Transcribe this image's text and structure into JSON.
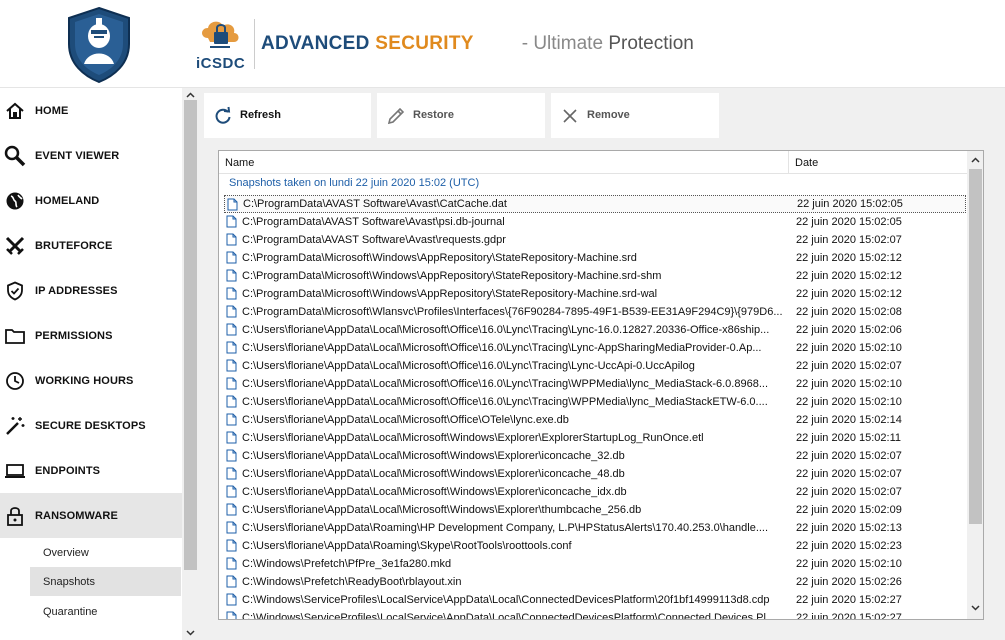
{
  "header": {
    "brand_short": "iCSDC",
    "title_main": "ADVANCED",
    "title_accent": "SECURITY",
    "subtitle_light": "- Ultimate ",
    "subtitle_dark": "Protection"
  },
  "sidebar": {
    "items": [
      {
        "label": "HOME",
        "icon": "home-icon"
      },
      {
        "label": "EVENT VIEWER",
        "icon": "magnifier-icon"
      },
      {
        "label": "HOMELAND",
        "icon": "globe-icon"
      },
      {
        "label": "BRUTEFORCE",
        "icon": "crossed-swords-icon"
      },
      {
        "label": "IP ADDRESSES",
        "icon": "shield-check-icon"
      },
      {
        "label": "PERMISSIONS",
        "icon": "folder-icon"
      },
      {
        "label": "WORKING HOURS",
        "icon": "clock-icon"
      },
      {
        "label": "SECURE DESKTOPS",
        "icon": "magic-wand-icon"
      },
      {
        "label": "ENDPOINTS",
        "icon": "laptop-icon"
      },
      {
        "label": "RANSOMWARE",
        "icon": "padlock-icon"
      }
    ],
    "subitems": [
      {
        "label": "Overview"
      },
      {
        "label": "Snapshots"
      },
      {
        "label": "Quarantine"
      }
    ],
    "active_item": "RANSOMWARE",
    "active_subitem": "Snapshots"
  },
  "toolbar": {
    "refresh_label": "Refresh",
    "restore_label": "Restore",
    "remove_label": "Remove"
  },
  "table": {
    "columns": [
      "Name",
      "Date"
    ],
    "group_label": "Snapshots taken on lundi 22 juin 2020 15:02 (UTC)",
    "rows": [
      {
        "path": "C:\\ProgramData\\AVAST Software\\Avast\\CatCache.dat",
        "date": "22 juin 2020 15:02:05"
      },
      {
        "path": "C:\\ProgramData\\AVAST Software\\Avast\\psi.db-journal",
        "date": "22 juin 2020 15:02:05"
      },
      {
        "path": "C:\\ProgramData\\AVAST Software\\Avast\\requests.gdpr",
        "date": "22 juin 2020 15:02:07"
      },
      {
        "path": "C:\\ProgramData\\Microsoft\\Windows\\AppRepository\\StateRepository-Machine.srd",
        "date": "22 juin 2020 15:02:12"
      },
      {
        "path": "C:\\ProgramData\\Microsoft\\Windows\\AppRepository\\StateRepository-Machine.srd-shm",
        "date": "22 juin 2020 15:02:12"
      },
      {
        "path": "C:\\ProgramData\\Microsoft\\Windows\\AppRepository\\StateRepository-Machine.srd-wal",
        "date": "22 juin 2020 15:02:12"
      },
      {
        "path": "C:\\ProgramData\\Microsoft\\Wlansvc\\Profiles\\Interfaces\\{76F90284-7895-49F1-B539-EE31A9F294C9}\\{979D6...",
        "date": "22 juin 2020 15:02:08"
      },
      {
        "path": "C:\\Users\\floriane\\AppData\\Local\\Microsoft\\Office\\16.0\\Lync\\Tracing\\Lync-16.0.12827.20336-Office-x86ship...",
        "date": "22 juin 2020 15:02:06"
      },
      {
        "path": "C:\\Users\\floriane\\AppData\\Local\\Microsoft\\Office\\16.0\\Lync\\Tracing\\Lync-AppSharingMediaProvider-0.Ap...",
        "date": "22 juin 2020 15:02:10"
      },
      {
        "path": "C:\\Users\\floriane\\AppData\\Local\\Microsoft\\Office\\16.0\\Lync\\Tracing\\Lync-UccApi-0.UccApilog",
        "date": "22 juin 2020 15:02:07"
      },
      {
        "path": "C:\\Users\\floriane\\AppData\\Local\\Microsoft\\Office\\16.0\\Lync\\Tracing\\WPPMedia\\lync_MediaStack-6.0.8968...",
        "date": "22 juin 2020 15:02:10"
      },
      {
        "path": "C:\\Users\\floriane\\AppData\\Local\\Microsoft\\Office\\16.0\\Lync\\Tracing\\WPPMedia\\lync_MediaStackETW-6.0....",
        "date": "22 juin 2020 15:02:10"
      },
      {
        "path": "C:\\Users\\floriane\\AppData\\Local\\Microsoft\\Office\\OTele\\lync.exe.db",
        "date": "22 juin 2020 15:02:14"
      },
      {
        "path": "C:\\Users\\floriane\\AppData\\Local\\Microsoft\\Windows\\Explorer\\ExplorerStartupLog_RunOnce.etl",
        "date": "22 juin 2020 15:02:11"
      },
      {
        "path": "C:\\Users\\floriane\\AppData\\Local\\Microsoft\\Windows\\Explorer\\iconcache_32.db",
        "date": "22 juin 2020 15:02:07"
      },
      {
        "path": "C:\\Users\\floriane\\AppData\\Local\\Microsoft\\Windows\\Explorer\\iconcache_48.db",
        "date": "22 juin 2020 15:02:07"
      },
      {
        "path": "C:\\Users\\floriane\\AppData\\Local\\Microsoft\\Windows\\Explorer\\iconcache_idx.db",
        "date": "22 juin 2020 15:02:07"
      },
      {
        "path": "C:\\Users\\floriane\\AppData\\Local\\Microsoft\\Windows\\Explorer\\thumbcache_256.db",
        "date": "22 juin 2020 15:02:09"
      },
      {
        "path": "C:\\Users\\floriane\\AppData\\Roaming\\HP Development Company, L.P\\HPStatusAlerts\\170.40.253.0\\handle....",
        "date": "22 juin 2020 15:02:13"
      },
      {
        "path": "C:\\Users\\floriane\\AppData\\Roaming\\Skype\\RootTools\\roottools.conf",
        "date": "22 juin 2020 15:02:23"
      },
      {
        "path": "C:\\Windows\\Prefetch\\PfPre_3e1fa280.mkd",
        "date": "22 juin 2020 15:02:10"
      },
      {
        "path": "C:\\Windows\\Prefetch\\ReadyBoot\\rblayout.xin",
        "date": "22 juin 2020 15:02:26"
      },
      {
        "path": "C:\\Windows\\ServiceProfiles\\LocalService\\AppData\\Local\\ConnectedDevicesPlatform\\20f1bf14999113d8.cdp",
        "date": "22 juin 2020 15:02:27"
      },
      {
        "path": "C:\\Windows\\ServiceProfiles\\LocalService\\AppData\\Local\\ConnectedDevicesPlatform\\Connected Devices Pl...",
        "date": "22 juin 2020 15:02:27"
      }
    ]
  },
  "colors": {
    "brand_blue": "#1e4c7a",
    "brand_orange": "#e08a1e",
    "group_blue": "#1e5fa8"
  }
}
